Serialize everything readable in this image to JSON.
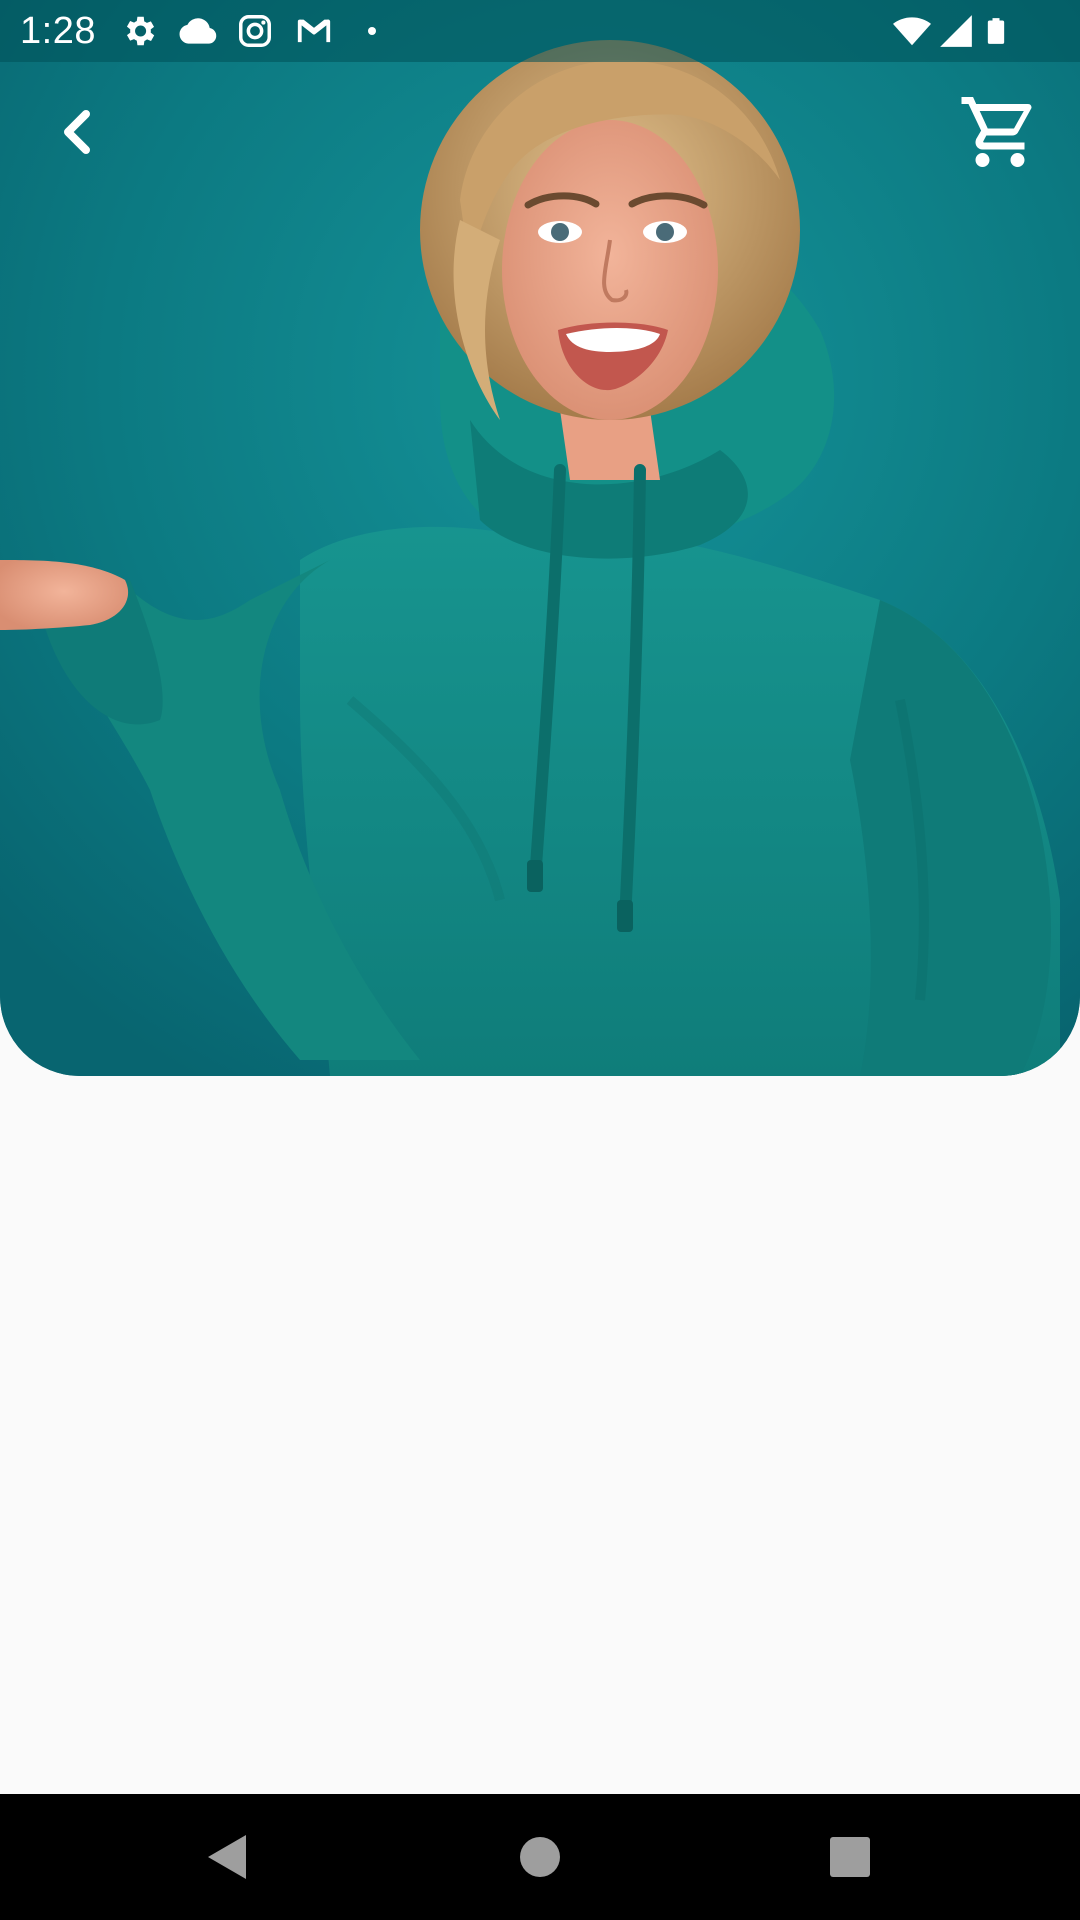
{
  "status_bar": {
    "time": "1:28",
    "left_icons": [
      "gear-icon",
      "cloud-icon",
      "instagram-icon",
      "gmail-icon",
      "notification-dot-icon"
    ],
    "right_icons": [
      "wifi-icon",
      "cell-signal-icon",
      "battery-icon"
    ]
  },
  "app_bar": {
    "back_icon": "chevron-left-icon",
    "cart_icon": "shopping-cart-icon"
  },
  "hero": {
    "subject": "product-photo",
    "colors": {
      "background": "#0d7d84",
      "garment": "#128a87"
    }
  },
  "navigation_bar": {
    "buttons": [
      "back-triangle-icon",
      "home-circle-icon",
      "recents-square-icon"
    ]
  },
  "theme": {
    "page_background": "#fafafa",
    "icon_color": "#ffffff",
    "nav_icon_color": "#9e9e9e"
  }
}
